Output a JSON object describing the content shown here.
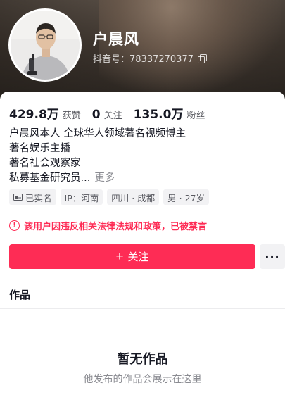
{
  "profile": {
    "name": "户晨风",
    "douyin_id": "抖音号：78337270377"
  },
  "stats": [
    {
      "value": "429.8万",
      "label": "获赞"
    },
    {
      "value": "0",
      "label": "关注"
    },
    {
      "value": "135.0万",
      "label": "粉丝"
    }
  ],
  "bio": {
    "lines": [
      "户晨风本人  全球华人领域著名视频博主",
      "著名娱乐主播",
      "著名社会观察家",
      "私募基金研究员..."
    ],
    "more": "更多"
  },
  "tags": [
    {
      "label": "已实名",
      "icon": "id-card-icon"
    },
    {
      "label": "IP：河南"
    },
    {
      "label": "四川 · 成都"
    },
    {
      "label": "男 · 27岁"
    }
  ],
  "warning": {
    "icon": "!",
    "text": "该用户因违反相关法律法规和政策，已被禁言"
  },
  "actions": {
    "follow_plus": "+",
    "follow_label": "关注",
    "more_label": "···"
  },
  "tabs": {
    "works": "作品"
  },
  "empty_state": {
    "title": "暂无作品",
    "subtitle": "他发布的作品会展示在这里"
  },
  "colors": {
    "accent": "#fe2c55",
    "tag_bg": "#f2f2f4"
  }
}
